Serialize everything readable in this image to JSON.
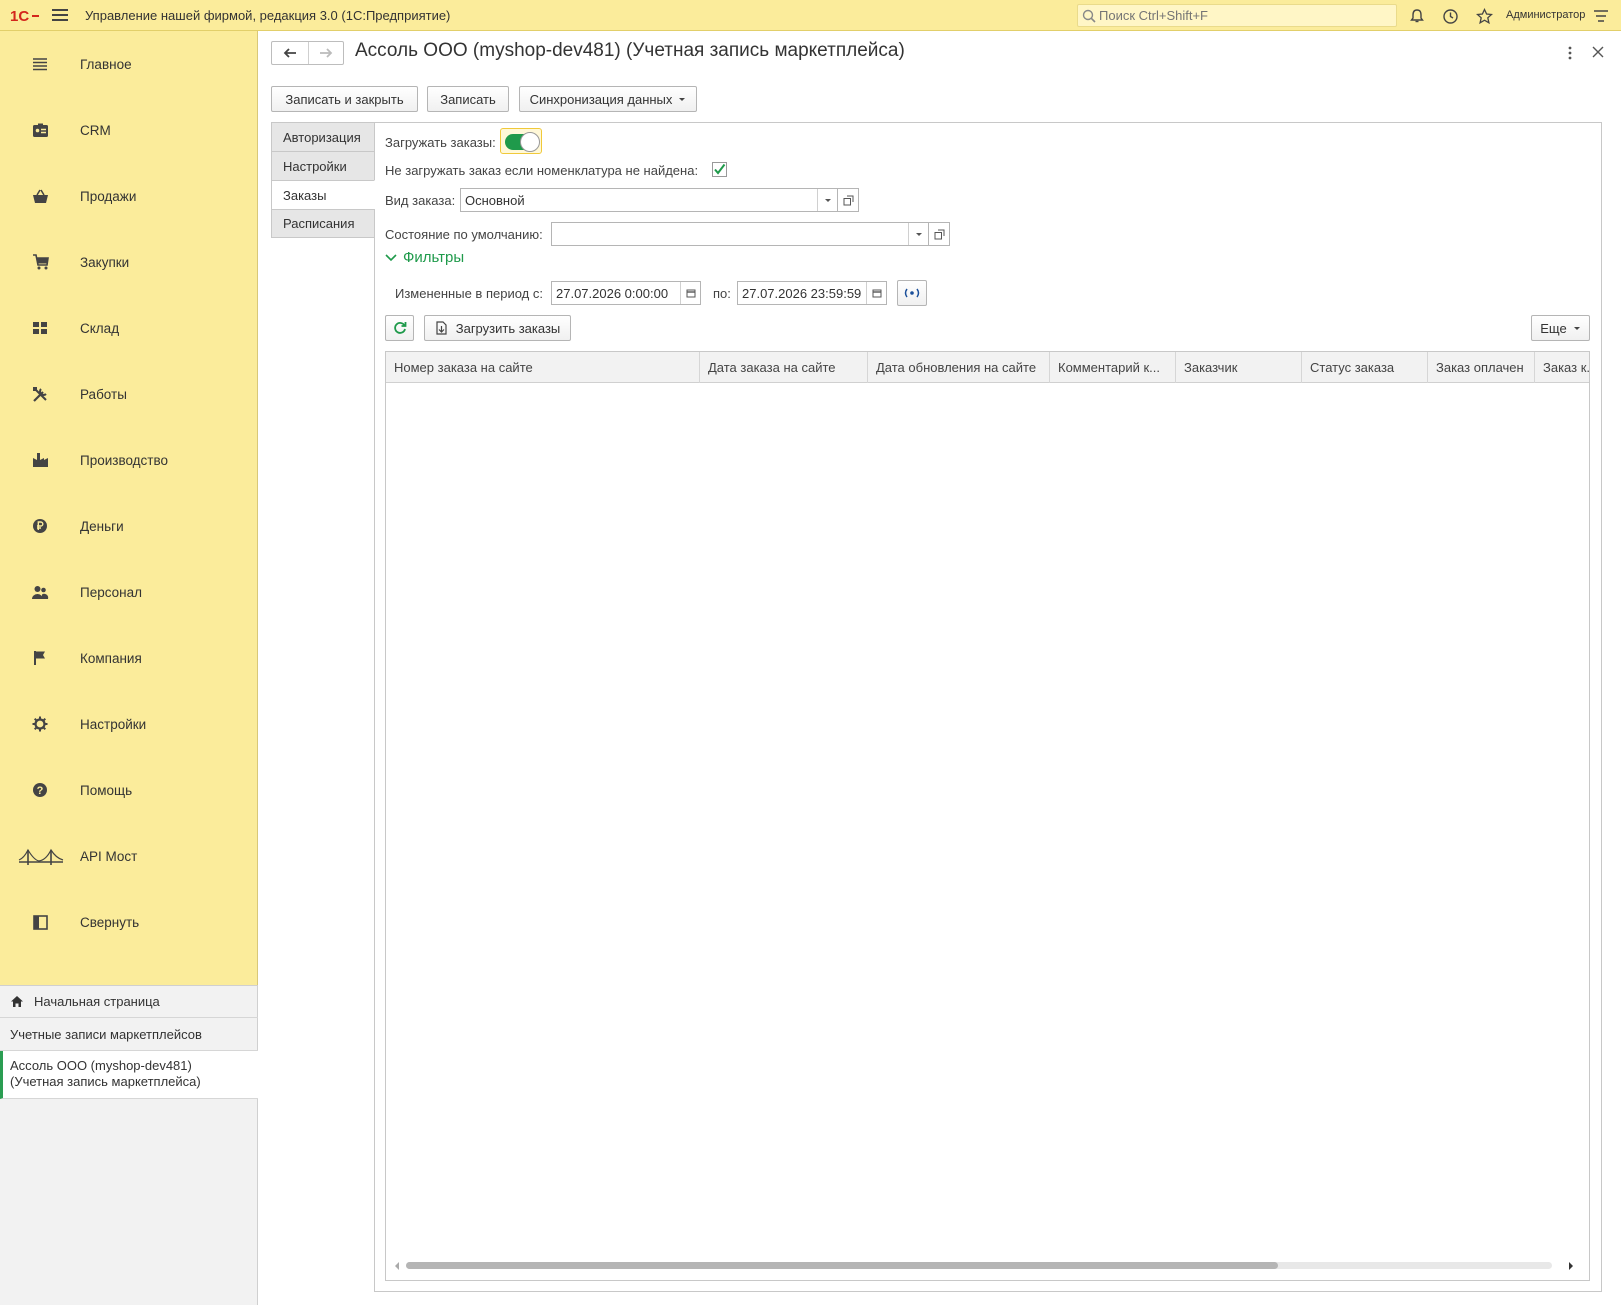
{
  "app": {
    "title": "Управление нашей фирмой, редакция 3.0  (1С:Предприятие)",
    "search_placeholder": "Поиск Ctrl+Shift+F",
    "user": "Администратор"
  },
  "sidebar": {
    "items": [
      {
        "label": "Главное",
        "icon": "menu-lines-icon"
      },
      {
        "label": "CRM",
        "icon": "crm-card-icon"
      },
      {
        "label": "Продажи",
        "icon": "basket-icon"
      },
      {
        "label": "Закупки",
        "icon": "cart-icon"
      },
      {
        "label": "Склад",
        "icon": "warehouse-grid-icon"
      },
      {
        "label": "Работы",
        "icon": "tools-icon"
      },
      {
        "label": "Производство",
        "icon": "factory-icon"
      },
      {
        "label": "Деньги",
        "icon": "ruble-coin-icon"
      },
      {
        "label": "Персонал",
        "icon": "people-icon"
      },
      {
        "label": "Компания",
        "icon": "flag-icon"
      },
      {
        "label": "Настройки",
        "icon": "gear-icon"
      },
      {
        "label": "Помощь",
        "icon": "help-icon"
      },
      {
        "label": "API Мост",
        "icon": "bridge-icon"
      },
      {
        "label": "Свернуть",
        "icon": "collapse-panel-icon"
      }
    ]
  },
  "open_windows": {
    "home": "Начальная страница",
    "list": "Учетные записи маркетплейсов",
    "current_line1": "Ассоль ООО (myshop-dev481)",
    "current_line2": "(Учетная запись маркетплейса)"
  },
  "form": {
    "title": "Ассоль ООО (myshop-dev481) (Учетная запись маркетплейса)",
    "buttons": {
      "save_close": "Записать и закрыть",
      "save": "Записать",
      "sync": "Синхронизация данных"
    },
    "tabs": [
      {
        "label": "Авторизация",
        "active": false
      },
      {
        "label": "Настройки",
        "active": false
      },
      {
        "label": "Заказы",
        "active": true
      },
      {
        "label": "Расписания",
        "active": false
      }
    ],
    "load_orders_label": "Загружать заказы:",
    "load_orders_on": true,
    "skip_missing_label": "Не загружать заказ если номенклатура не найдена:",
    "skip_missing_checked": true,
    "order_kind_label": "Вид заказа:",
    "order_kind_value": "Основной",
    "default_state_label": "Состояние по умолчанию:",
    "default_state_value": "",
    "filters_title": "Фильтры",
    "period_label": "Измененные в период с:",
    "period_from": "27.07.2026  0:00:00",
    "period_to_label": "по:",
    "period_to": "27.07.2026 23:59:59",
    "load_orders_button": "Загрузить заказы",
    "more_button": "Еще"
  },
  "table": {
    "columns": [
      "Номер заказа на сайте",
      "Дата заказа на сайте",
      "Дата обновления на сайте",
      "Комментарий к...",
      "Заказчик",
      "Статус заказа",
      "Заказ оплачен",
      "Заказ к..."
    ],
    "rows": []
  },
  "colors": {
    "accent_yellow": "#fbec9b",
    "accent_green": "#1f9a4b"
  }
}
